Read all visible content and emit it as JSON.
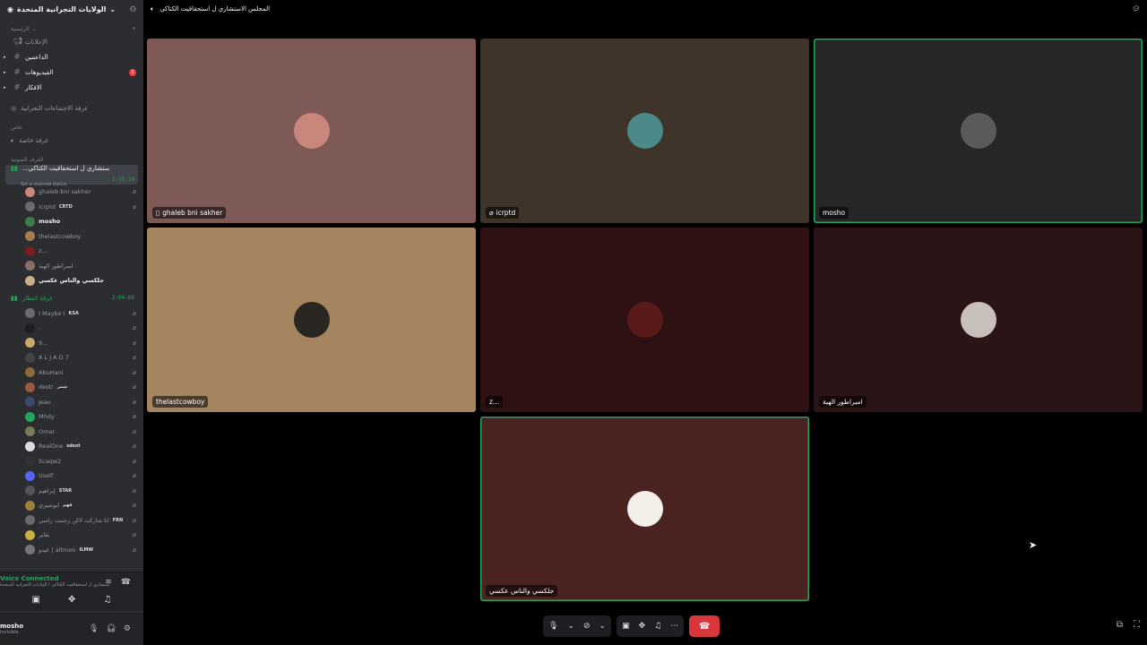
{
  "server": {
    "name": "الولايات التجرانية المتحدة"
  },
  "categories": {
    "main": "الرئيسية",
    "private": "خاص",
    "voice": "الغرف الصوتية"
  },
  "text_channels": [
    {
      "name": "الإعلانات",
      "unread": false,
      "badge": ""
    },
    {
      "name": "الداعمين",
      "unread": true,
      "badge": ""
    },
    {
      "name": "الفيديوهات",
      "unread": true,
      "badge": "1"
    },
    {
      "name": "الافكار",
      "unread": true,
      "badge": ""
    }
  ],
  "meeting_room": "غرفة الاجتماعات التجرانية",
  "private_room": "غرفة خاصة",
  "active_voice": {
    "name": "المجلس الاستشاري ل استحقاقيت الكتاكي",
    "short_name": "...ستشاري ل استحقاقيت الكتاكي",
    "timer": "1:35:19",
    "status": "Set a channel status",
    "members": [
      {
        "name": "ghaleb bni sakher",
        "tag": "",
        "color": "#c9867a",
        "bright": false
      },
      {
        "name": "icrptd",
        "tag": "CRTD",
        "color": "#6b6b6b",
        "bright": false
      },
      {
        "name": "mosho",
        "tag": "",
        "color": "#3b7d4a",
        "bright": true
      },
      {
        "name": "thelastcowboy",
        "tag": "",
        "color": "#a77d4c",
        "bright": false
      },
      {
        "name": "z...",
        "tag": "",
        "color": "#7a1d1d",
        "bright": false
      },
      {
        "name": "امبراطور الهبة",
        "tag": "",
        "color": "#8a6e66",
        "bright": false
      },
      {
        "name": "جلكسي والناس عكسي",
        "tag": "",
        "color": "#c7b08a",
        "bright": true
      }
    ]
  },
  "second_voice": {
    "name": "غرفة انتظار",
    "timer": "2:04:08",
    "members": [
      {
        "name": "I Maybe I",
        "tag": "KSA"
      },
      {
        "name": ".",
        "tag": ""
      },
      {
        "name": "9...",
        "tag": ""
      },
      {
        "name": "A L J A D 7",
        "tag": ""
      },
      {
        "name": "AbuHani",
        "tag": ""
      },
      {
        "name": "destr",
        "tag": "شمر"
      },
      {
        "name": "Jeao",
        "tag": ""
      },
      {
        "name": "Mhdy",
        "tag": ""
      },
      {
        "name": "Omar",
        "tag": ""
      },
      {
        "name": "RealOne",
        "tag": "sdsot"
      },
      {
        "name": "Scaqw2",
        "tag": ""
      },
      {
        "name": "Uself",
        "tag": ""
      },
      {
        "name": "إبراهيم",
        "tag": "STAR"
      },
      {
        "name": "ابوشيري",
        "tag": "فهم"
      },
      {
        "name": "انا شاركت لاكن زحمت راسي",
        "tag": "FRN"
      },
      {
        "name": "بقاير",
        "tag": ""
      },
      {
        "name": "عبدو | altmon",
        "tag": "ILMW"
      }
    ]
  },
  "voice_panel": {
    "label": "Voice Connected",
    "sub": "ستشاري ل استحقاقيت الكتاكي / الولايات التجرانية المتحدة"
  },
  "user": {
    "name": "mosho",
    "status": "Invisible"
  },
  "topbar_title": "المجلس الاستشاري ل استحقاقيت الكتاكي",
  "tiles": [
    {
      "name": "ghaleb bni sakher",
      "bg": "#7e5a57",
      "avatar": "#c9867a",
      "speaking": false,
      "icon": "phone"
    },
    {
      "name": "icrptd",
      "bg": "#3f342a",
      "avatar": "#4b8a88",
      "speaking": false,
      "icon": "mute"
    },
    {
      "name": "mosho",
      "bg": "#262626",
      "avatar": "#5a5a5a",
      "speaking": true,
      "icon": ""
    },
    {
      "name": "thelastcowboy",
      "bg": "#a48560",
      "avatar": "#2a2621",
      "speaking": false,
      "icon": ""
    },
    {
      "name": "z...",
      "bg": "#2e1112",
      "avatar": "#5a1a1a",
      "speaking": false,
      "icon": ""
    },
    {
      "name": "امبراطور الهبة",
      "bg": "#2a1416",
      "avatar": "#c9c0bb",
      "speaking": false,
      "icon": ""
    },
    {
      "name": "جلكسي والناس عكسي",
      "bg": "#4b2422",
      "avatar": "#f4efe8",
      "speaking": true,
      "icon": ""
    }
  ]
}
